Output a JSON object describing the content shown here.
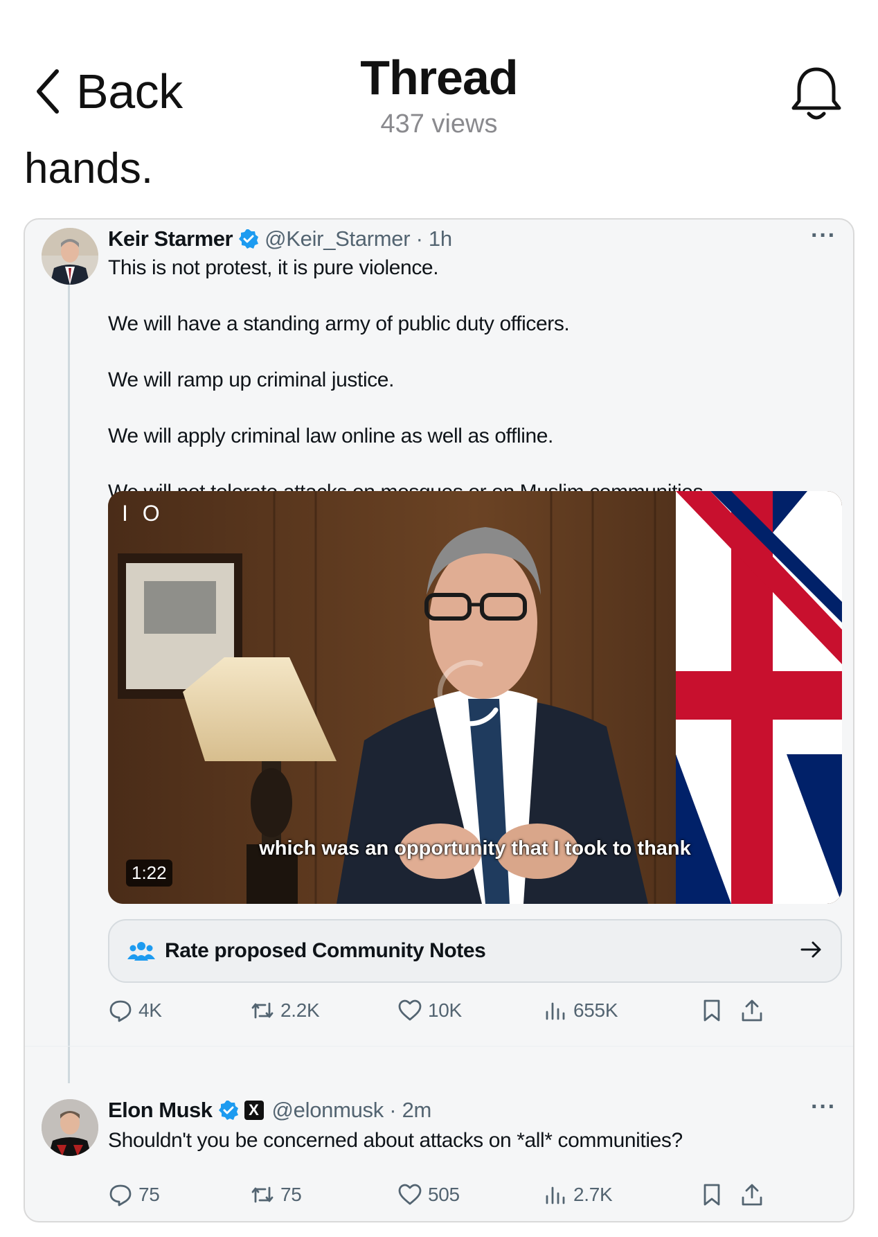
{
  "nav": {
    "back_label": "Back",
    "title": "Thread",
    "views": "437 views",
    "back_icon": "chevron-left-icon",
    "bell_icon": "bell-icon"
  },
  "previous_text": "hands.",
  "embedded_post": {
    "author": {
      "name": "Keir Starmer",
      "handle": "@Keir_Starmer · 1h",
      "verified": true
    },
    "text": [
      "This is not protest, it is pure violence.",
      "We will have a standing army of public duty officers.",
      "We will ramp up criminal justice.",
      "We will apply criminal law online as well as offline.",
      "We will not tolerate attacks on mosques or on Muslim communities."
    ],
    "video": {
      "top_label": "I O",
      "caption": "which was an opportunity that I took to thank",
      "duration": "1:22"
    },
    "community_notes_label": "Rate proposed Community Notes",
    "stats": {
      "replies": "4K",
      "reposts": "2.2K",
      "likes": "10K",
      "views": "655K"
    }
  },
  "reply_post": {
    "author": {
      "name": "Elon Musk",
      "handle": "@elonmusk · 2m",
      "verified": true,
      "affiliate_badge": "X"
    },
    "text": "Shouldn't you be concerned about attacks on *all* communities?",
    "stats": {
      "replies": "75",
      "reposts": "75",
      "likes": "505",
      "views": "2.7K"
    }
  },
  "colors": {
    "verified_blue": "#1d9bf0",
    "muted_gray": "#536471",
    "card_background": "#f5f6f7"
  }
}
